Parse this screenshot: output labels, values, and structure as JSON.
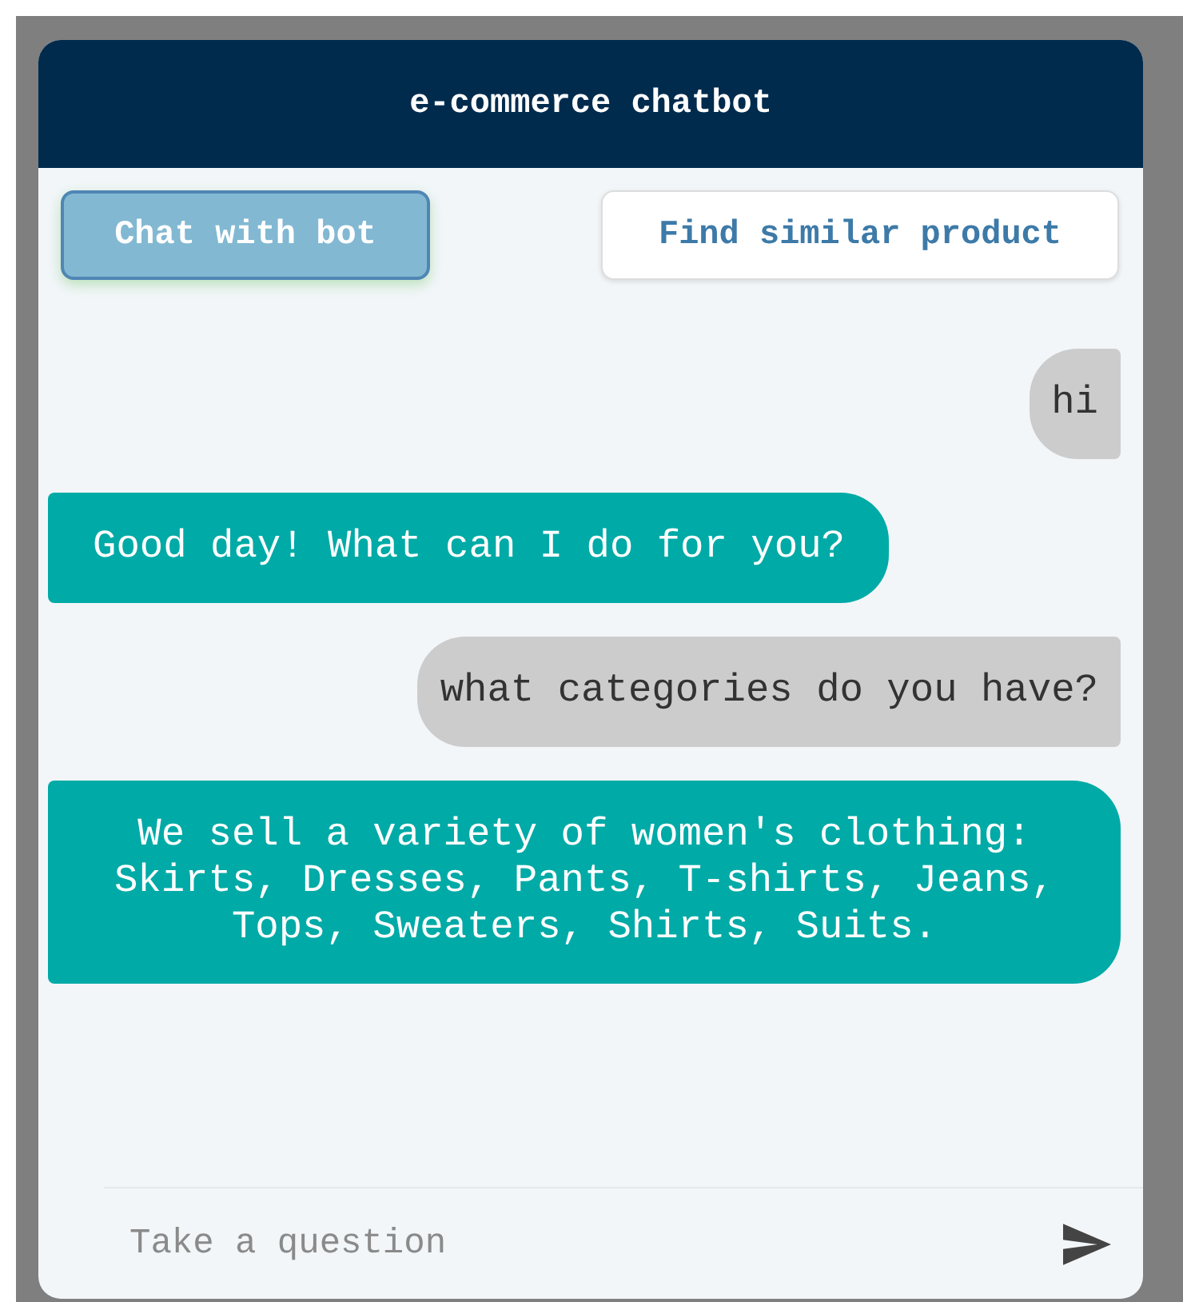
{
  "window": {
    "title": "e-commerce chatbot"
  },
  "tabs": [
    {
      "label": "Chat with bot",
      "selected": true
    },
    {
      "label": "Find similar product",
      "selected": false
    }
  ],
  "messages": [
    {
      "kind": "user",
      "text": "hi"
    },
    {
      "kind": "bot",
      "text": "Good day! What can I do for you?"
    },
    {
      "kind": "user",
      "text": "what categories do you have?"
    },
    {
      "kind": "bot",
      "text": "We sell a variety of women's clothing: Skirts, Dresses, Pants, T-shirts, Jeans, Tops, Sweaters, Shirts, Suits."
    }
  ],
  "input": {
    "placeholder": "Take a question"
  }
}
